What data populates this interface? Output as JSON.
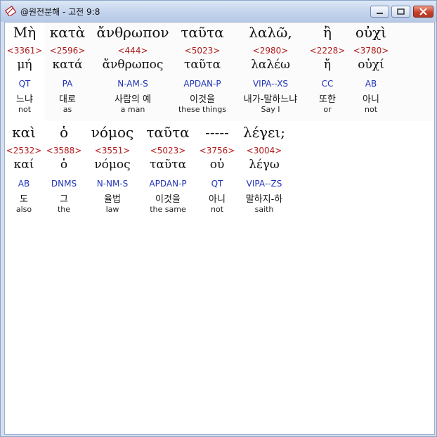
{
  "window": {
    "title": "@원전분해 - 고전 9:8"
  },
  "controls": {
    "minimize": "minimize",
    "maximize": "maximize",
    "close": "close"
  },
  "lines": [
    {
      "words": [
        {
          "greek": "Μὴ",
          "strong": "<3361>",
          "lexeme": "μή",
          "parse": "QT",
          "korean": "느냐",
          "english": "not"
        },
        {
          "greek": "κατὰ",
          "strong": "<2596>",
          "lexeme": "κατά",
          "parse": "PA",
          "korean": "대로",
          "english": "as"
        },
        {
          "greek": "ἄνθρωπον",
          "strong": "<444>",
          "lexeme": "ἄνθρωπος",
          "parse": "N-AM-S",
          "korean": "사람의 예",
          "english": "a man"
        },
        {
          "greek": "ταῦτα",
          "strong": "<5023>",
          "lexeme": "ταῦτα",
          "parse": "APDAN-P",
          "korean": "이것을",
          "english": "these things"
        },
        {
          "greek": "λαλῶ,",
          "strong": "<2980>",
          "lexeme": "λαλέω",
          "parse": "VIPA--XS",
          "korean": "내가-말하느냐",
          "english": "Say I"
        },
        {
          "greek": "ἢ",
          "strong": "<2228>",
          "lexeme": "ἤ",
          "parse": "CC",
          "korean": "또한",
          "english": "or"
        },
        {
          "greek": "οὐχὶ",
          "strong": "<3780>",
          "lexeme": "οὐχί",
          "parse": "AB",
          "korean": "아니",
          "english": "not"
        }
      ]
    },
    {
      "words": [
        {
          "greek": "καὶ",
          "strong": "<2532>",
          "lexeme": "καί",
          "parse": "AB",
          "korean": "도",
          "english": "also"
        },
        {
          "greek": "ὁ",
          "strong": "<3588>",
          "lexeme": "ὁ",
          "parse": "DNMS",
          "korean": "그",
          "english": "the"
        },
        {
          "greek": "νόμος",
          "strong": "<3551>",
          "lexeme": "νόμος",
          "parse": "N-NM-S",
          "korean": "율법",
          "english": "law"
        },
        {
          "greek": "ταῦτα",
          "strong": "<5023>",
          "lexeme": "ταῦτα",
          "parse": "APDAN-P",
          "korean": "이것을",
          "english": "the same"
        },
        {
          "greek": "-----",
          "strong": "<3756>",
          "lexeme": "οὐ",
          "parse": "QT",
          "korean": "아니",
          "english": "not"
        },
        {
          "greek": "λέγει;",
          "strong": "<3004>",
          "lexeme": "λέγω",
          "parse": "VIPA--ZS",
          "korean": "말하지-하",
          "english": "saith"
        }
      ]
    }
  ]
}
